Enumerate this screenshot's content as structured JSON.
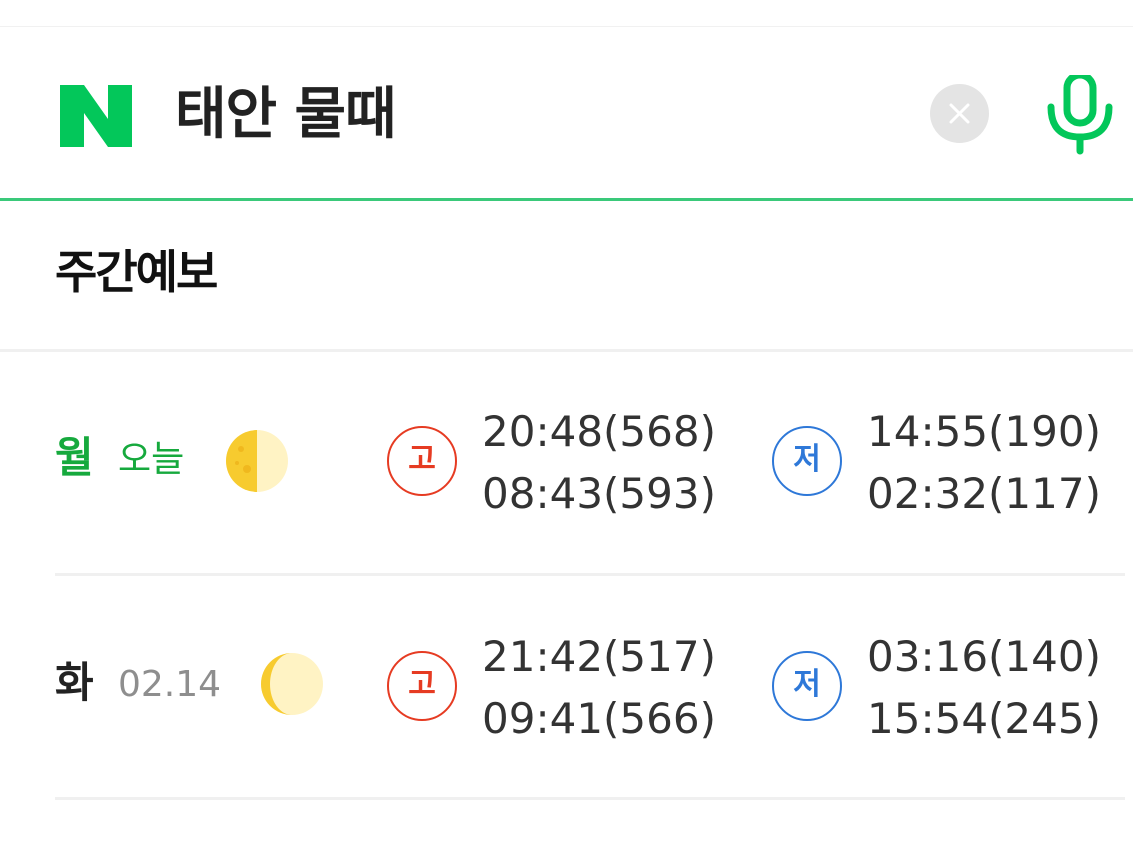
{
  "search": {
    "query": "태안 물때",
    "logo_letter": "N"
  },
  "colors": {
    "brand_green": "#03c75a",
    "underline_green": "#3ac97a",
    "today_green": "#16a93d",
    "high_tide_red": "#e63b22",
    "low_tide_blue": "#2e78d8"
  },
  "icons": {
    "clear": "close-icon",
    "mic": "microphone-icon",
    "moon_row1": "half-moon-icon",
    "moon_row2": "crescent-moon-icon"
  },
  "section": {
    "title": "주간예보"
  },
  "rows": [
    {
      "day": "월",
      "sub": "오늘",
      "high_label": "고",
      "high_times": [
        "20:48(568)",
        "08:43(593)"
      ],
      "low_label": "저",
      "low_times": [
        "14:55(190)",
        "02:32(117)"
      ]
    },
    {
      "day": "화",
      "sub": "02.14",
      "high_label": "고",
      "high_times": [
        "21:42(517)",
        "09:41(566)"
      ],
      "low_label": "저",
      "low_times": [
        "03:16(140)",
        "15:54(245)"
      ]
    }
  ]
}
